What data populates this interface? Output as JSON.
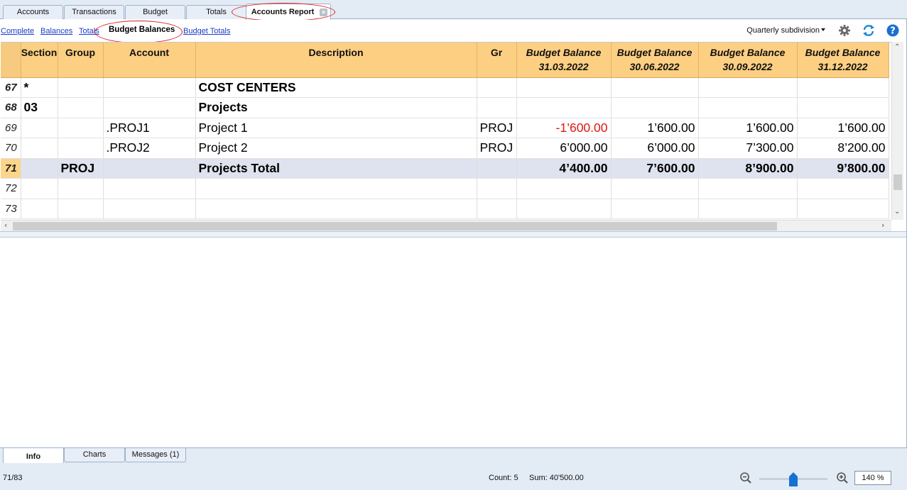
{
  "top_tabs": [
    {
      "label": "Accounts"
    },
    {
      "label": "Transactions"
    },
    {
      "label": "Budget"
    },
    {
      "label": "Totals"
    },
    {
      "label": "Accounts Report",
      "active": true
    }
  ],
  "view_links": [
    {
      "label": "Complete"
    },
    {
      "label": "Balances"
    },
    {
      "label": "Totals"
    },
    {
      "label": "Budget Balances",
      "active": true
    },
    {
      "label": "Budget Totals"
    }
  ],
  "toolbar": {
    "subdivision_label": "Quarterly subdivision",
    "icons": [
      "gear-icon",
      "refresh-icon",
      "help-icon"
    ]
  },
  "table": {
    "columns": [
      "Section",
      "Group",
      "Account",
      "Description",
      "Gr",
      "Budget Balance 31.03.2022",
      "Budget Balance 30.06.2022",
      "Budget Balance 30.09.2022",
      "Budget Balance 31.12.2022"
    ],
    "column_headers": {
      "section": "Section",
      "group": "Group",
      "account": "Account",
      "description": "Description",
      "gr": "Gr",
      "bb_title": "Budget Balance",
      "bb_dates": [
        "31.03.2022",
        "30.06.2022",
        "30.09.2022",
        "31.12.2022"
      ]
    },
    "rows": [
      {
        "n": "67",
        "section": "*",
        "group": "",
        "account": "",
        "description": "COST CENTERS",
        "gr": "",
        "b1": "",
        "b2": "",
        "b3": "",
        "b4": ""
      },
      {
        "n": "68",
        "section": "03",
        "group": "",
        "account": "",
        "description": "Projects",
        "gr": "",
        "b1": "",
        "b2": "",
        "b3": "",
        "b4": ""
      },
      {
        "n": "69",
        "section": "",
        "group": "",
        "account": ".PROJ1",
        "description": "Project 1",
        "gr": "PROJ",
        "b1": "-1’600.00",
        "b2": "1’600.00",
        "b3": "1’600.00",
        "b4": "1’600.00"
      },
      {
        "n": "70",
        "section": "",
        "group": "",
        "account": ".PROJ2",
        "description": "Project 2",
        "gr": "PROJ",
        "b1": "6’000.00",
        "b2": "6’000.00",
        "b3": "7’300.00",
        "b4": "8’200.00"
      },
      {
        "n": "71",
        "section": "",
        "group": "PROJ",
        "account": "",
        "description": "Projects Total",
        "gr": "",
        "b1": "4’400.00",
        "b2": "7’600.00",
        "b3": "8’900.00",
        "b4": "9’800.00"
      },
      {
        "n": "72",
        "section": "",
        "group": "",
        "account": "",
        "description": "",
        "gr": "",
        "b1": "",
        "b2": "",
        "b3": "",
        "b4": ""
      },
      {
        "n": "73",
        "section": "",
        "group": "",
        "account": "",
        "description": "",
        "gr": "",
        "b1": "",
        "b2": "",
        "b3": "",
        "b4": ""
      }
    ],
    "negative_color": "#e21414",
    "header_color": "#fdcf82",
    "total_row_color": "#dfe3ef"
  },
  "bottom_tabs": [
    {
      "label": "Info",
      "active": true
    },
    {
      "label": "Charts"
    },
    {
      "label": "Messages (1)"
    }
  ],
  "status": {
    "position": "71/83",
    "count": "Count: 5",
    "sum": "Sum: 40'500.00",
    "zoom": "140 %",
    "zoom_level": 0.5
  },
  "highlight_color": "#d81e1e"
}
